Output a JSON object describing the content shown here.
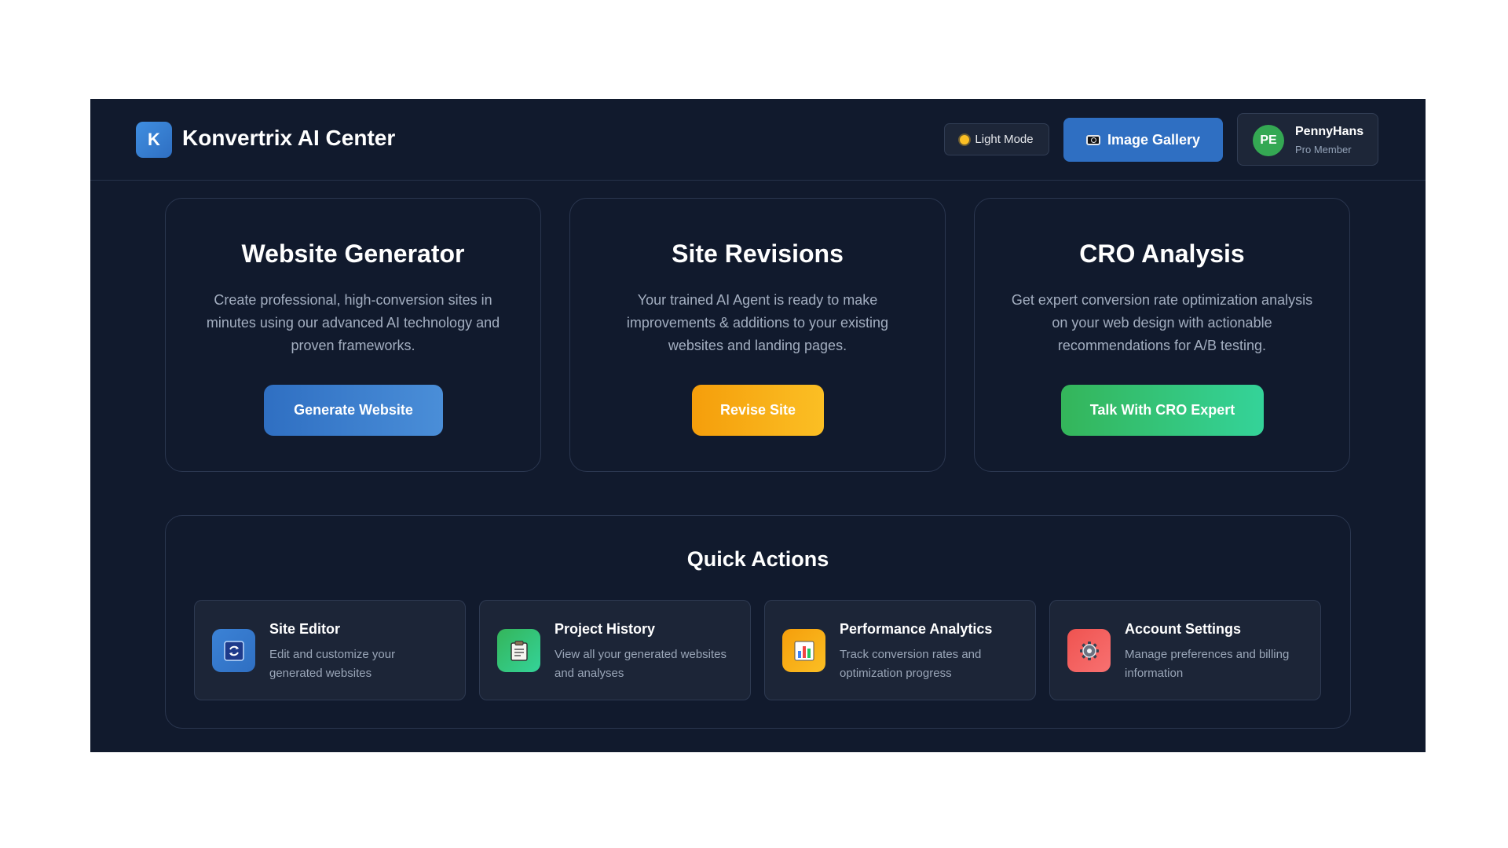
{
  "header": {
    "logo_letter": "K",
    "title": "Konvertrix AI Center",
    "light_mode_label": "Light Mode",
    "gallery_label": "Image Gallery",
    "user": {
      "initials": "PE",
      "name": "PennyHans",
      "role": "Pro Member"
    }
  },
  "cards": [
    {
      "title": "Website Generator",
      "description": "Create professional, high-conversion sites in minutes using our advanced AI technology and proven frameworks.",
      "button": "Generate Website"
    },
    {
      "title": "Site Revisions",
      "description": "Your trained AI Agent is ready to make improvements & additions to your existing websites and landing pages.",
      "button": "Revise Site"
    },
    {
      "title": "CRO Analysis",
      "description": "Get expert conversion rate optimization analysis on your web design with actionable recommendations for A/B testing.",
      "button": "Talk With CRO Expert"
    }
  ],
  "quick_actions": {
    "title": "Quick Actions",
    "items": [
      {
        "icon": "refresh-icon",
        "title": "Site Editor",
        "description": "Edit and customize your generated websites"
      },
      {
        "icon": "clipboard-icon",
        "title": "Project History",
        "description": "View all your generated websites and analyses"
      },
      {
        "icon": "bar-chart-icon",
        "title": "Performance Analytics",
        "description": "Track conversion rates and optimization progress"
      },
      {
        "icon": "gear-icon",
        "title": "Account Settings",
        "description": "Manage preferences and billing information"
      }
    ]
  },
  "colors": {
    "background": "#111a2d",
    "primary_blue": "#2f6fc2",
    "amber": "#f59e0b",
    "green": "#34c46a",
    "red": "#ef5350"
  }
}
